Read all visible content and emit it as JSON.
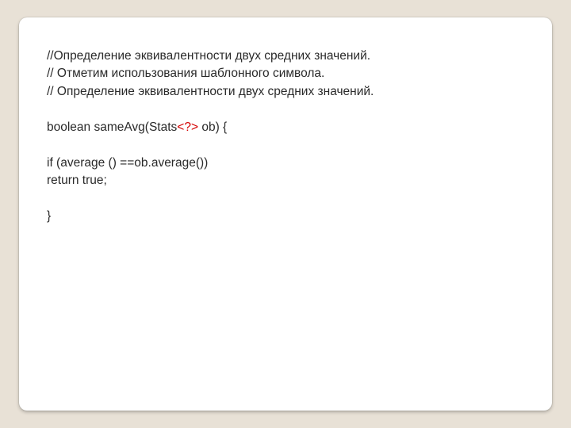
{
  "code": {
    "line1": "//Определение эквивалентности двух средних значений.",
    "line2": "// Отметим использования шаблонного символа.",
    "line3": "// Определение эквивалентности двух средних значений.",
    "line4_a": "boolean sameAvg(Stats",
    "line4_red": "<?>",
    "line4_b": " ob) {",
    "line5": "if (average () ==ob.average())",
    "line6": "return true;",
    "line7": "}"
  }
}
